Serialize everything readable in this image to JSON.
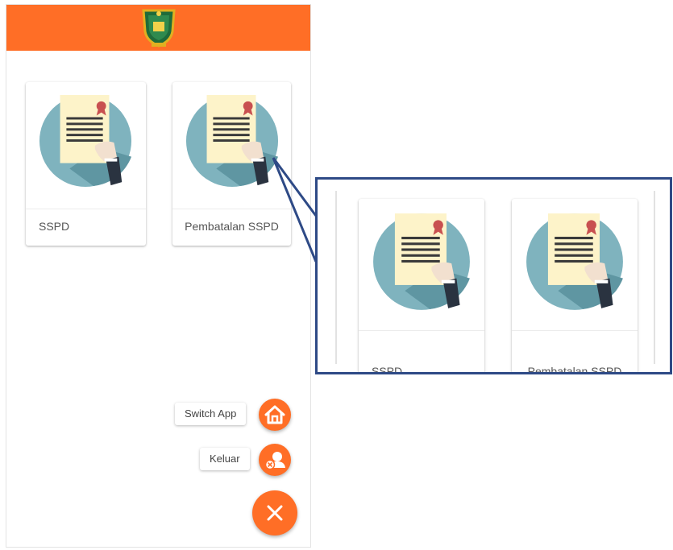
{
  "app": {
    "header_color": "#ff6e26",
    "logo": "regency-coat-of-arms-logo"
  },
  "menu": {
    "cards": [
      {
        "label": "SSPD",
        "icon": "certificate-document-icon"
      },
      {
        "label": "Pembatalan SSPD",
        "icon": "certificate-document-icon"
      }
    ]
  },
  "fab_menu": {
    "switch_app_label": "Switch App",
    "switch_app_icon": "home-icon",
    "logout_label": "Keluar",
    "logout_icon": "user-remove-icon",
    "close_icon": "close-icon",
    "accent_color": "#ff6e26"
  },
  "zoom_callout": {
    "border_color": "#2e4a86",
    "cards": [
      {
        "label": "SSPD"
      },
      {
        "label": "Pembatalan SSPD"
      }
    ]
  }
}
